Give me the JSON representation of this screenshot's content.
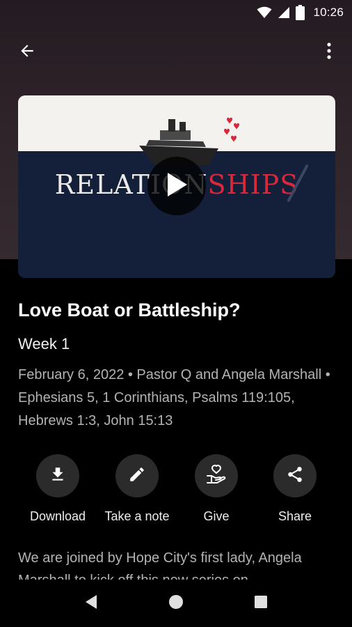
{
  "status_bar": {
    "time": "10:26",
    "icons": [
      "wifi-icon",
      "cell-signal-icon",
      "battery-icon"
    ]
  },
  "app_bar": {
    "back_icon": "arrow-back-icon",
    "menu_icon": "more-vert-icon"
  },
  "media": {
    "artwork_title_part1": "RELATION",
    "artwork_title_part2": "SHIPS",
    "play_icon": "play-icon"
  },
  "sermon": {
    "title": "Love Boat or Battleship?",
    "subtitle": "Week 1",
    "meta": "February 6, 2022 • Pastor Q and Angela Marshall • Ephesians 5, 1 Corinthians, Psalms 119:105, Hebrews 1:3, John 15:13",
    "description": "We are joined by Hope City's first lady, Angela Marshall to kick off this new series on"
  },
  "actions": [
    {
      "label": "Download",
      "icon": "download-icon"
    },
    {
      "label": "Take a note",
      "icon": "pencil-icon"
    },
    {
      "label": "Give",
      "icon": "give-hand-heart-icon"
    },
    {
      "label": "Share",
      "icon": "share-icon"
    }
  ],
  "colors": {
    "background": "#000000",
    "header_gradient_top": "#241b22",
    "header_gradient_bottom": "#352a2f",
    "muted_text": "#b3b3b3",
    "action_circle": "#2b2b2b",
    "artwork_accent": "#d8283c",
    "artwork_sea": "#14203a"
  },
  "nav_bar": {
    "icons": [
      "nav-back-icon",
      "nav-home-icon",
      "nav-recents-icon"
    ]
  }
}
